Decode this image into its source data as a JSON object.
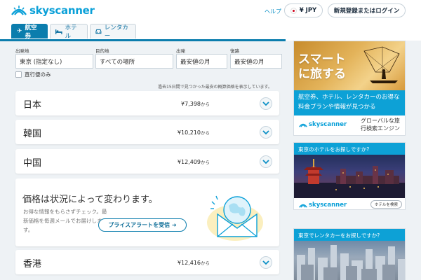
{
  "header": {
    "logo_text": "skyscanner",
    "help_link": "ヘルプ",
    "currency_label": "¥ JPY",
    "login_button": "新規登録またはログイン"
  },
  "tabs": [
    {
      "label": "航空券",
      "icon": "airplane-icon",
      "active": true
    },
    {
      "label": "ホテル",
      "icon": "bed-icon",
      "active": false
    },
    {
      "label": "レンタカー",
      "icon": "car-icon",
      "active": false
    }
  ],
  "search": {
    "from_label": "出発地",
    "from_value": "東京 (指定なし)",
    "to_label": "目的地",
    "to_value": "すべての場所",
    "depart_label": "出発",
    "depart_value": "最安値の月",
    "return_label": "復路",
    "return_value": "最安値の月",
    "direct_only_label": "直行便のみ",
    "note": "過去15日間で見つかった最安の概算価格を表示しています。"
  },
  "results": [
    {
      "destination": "日本",
      "price": "¥7,398",
      "suffix": "から"
    },
    {
      "destination": "韓国",
      "price": "¥10,210",
      "suffix": "から"
    },
    {
      "destination": "中国",
      "price": "¥12,409",
      "suffix": "から"
    },
    {
      "destination": "香港",
      "price": "¥12,416",
      "suffix": "から"
    }
  ],
  "price_alert": {
    "title": "価格は状況によって変わります。",
    "description": "お得な情報をもらさずチェック。最新価格を毎週メールでお届けします。",
    "button": "プライスアラートを受信 ➜"
  },
  "ads": {
    "flights": {
      "photo_title_line1": "スマート",
      "photo_title_line2": "に旅する",
      "body": "航空券、ホテル、レンタカーのお得な料金プランや情報が見つかる",
      "logo_text": "skyscanner",
      "tagline": "グローバルな旅行検索エンジン"
    },
    "hotels": {
      "heading": "東京のホテルをお探しですか?",
      "logo_text": "skyscanner",
      "button": "ホテルを検索"
    },
    "cars": {
      "heading": "東京でレンタカーをお探しですか?"
    }
  },
  "colors": {
    "brand": "#0aa0d8",
    "tab_active": "#0b7dad",
    "ad_blue": "#0da1d6"
  }
}
